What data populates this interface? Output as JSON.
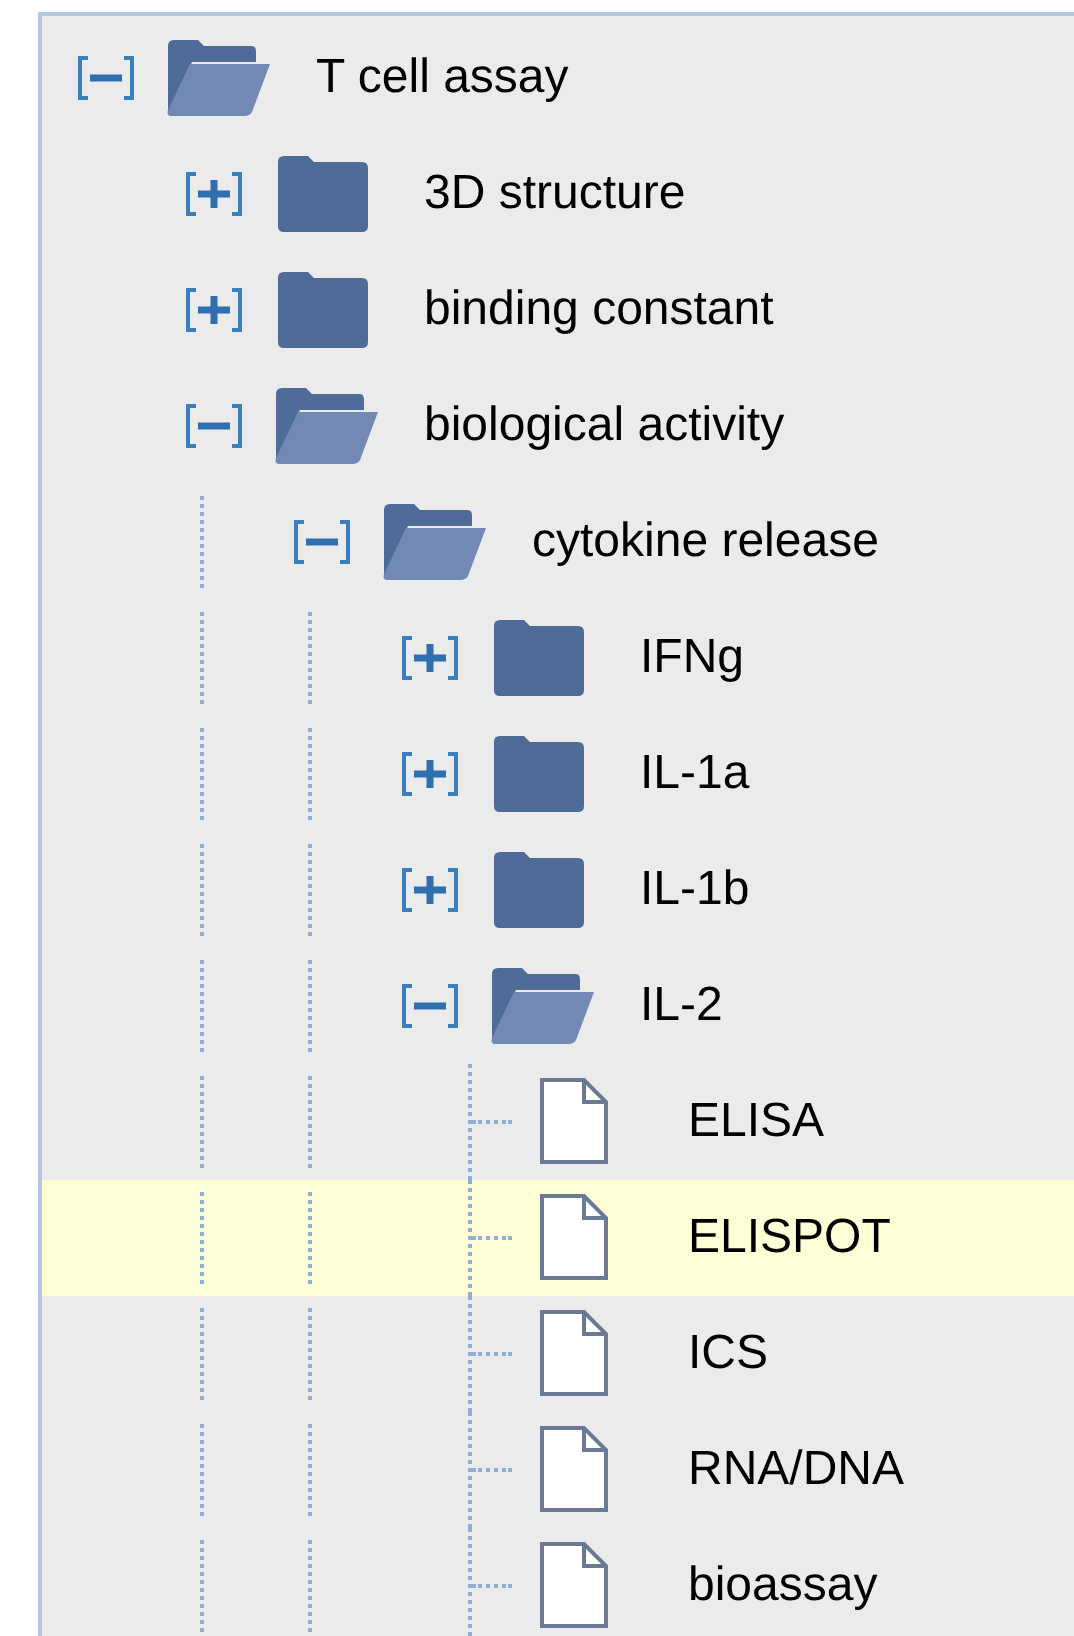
{
  "tree": [
    {
      "label": "T cell assay",
      "kind": "folder",
      "expanded": true,
      "selected": false,
      "children": [
        {
          "label": "3D structure",
          "kind": "folder",
          "expanded": false,
          "selected": false
        },
        {
          "label": "binding constant",
          "kind": "folder",
          "expanded": false,
          "selected": false
        },
        {
          "label": "biological activity",
          "kind": "folder",
          "expanded": true,
          "selected": false,
          "children": [
            {
              "label": "cytokine release",
              "kind": "folder",
              "expanded": true,
              "selected": false,
              "children": [
                {
                  "label": "IFNg",
                  "kind": "folder",
                  "expanded": false,
                  "selected": false
                },
                {
                  "label": "IL-1a",
                  "kind": "folder",
                  "expanded": false,
                  "selected": false
                },
                {
                  "label": "IL-1b",
                  "kind": "folder",
                  "expanded": false,
                  "selected": false
                },
                {
                  "label": "IL-2",
                  "kind": "folder",
                  "expanded": true,
                  "selected": false,
                  "children": [
                    {
                      "label": "ELISA",
                      "kind": "file",
                      "selected": false
                    },
                    {
                      "label": "ELISPOT",
                      "kind": "file",
                      "selected": true
                    },
                    {
                      "label": "ICS",
                      "kind": "file",
                      "selected": false
                    },
                    {
                      "label": "RNA/DNA",
                      "kind": "file",
                      "selected": false
                    },
                    {
                      "label": "bioassay",
                      "kind": "file",
                      "selected": false
                    }
                  ]
                }
              ]
            }
          ]
        }
      ]
    }
  ]
}
